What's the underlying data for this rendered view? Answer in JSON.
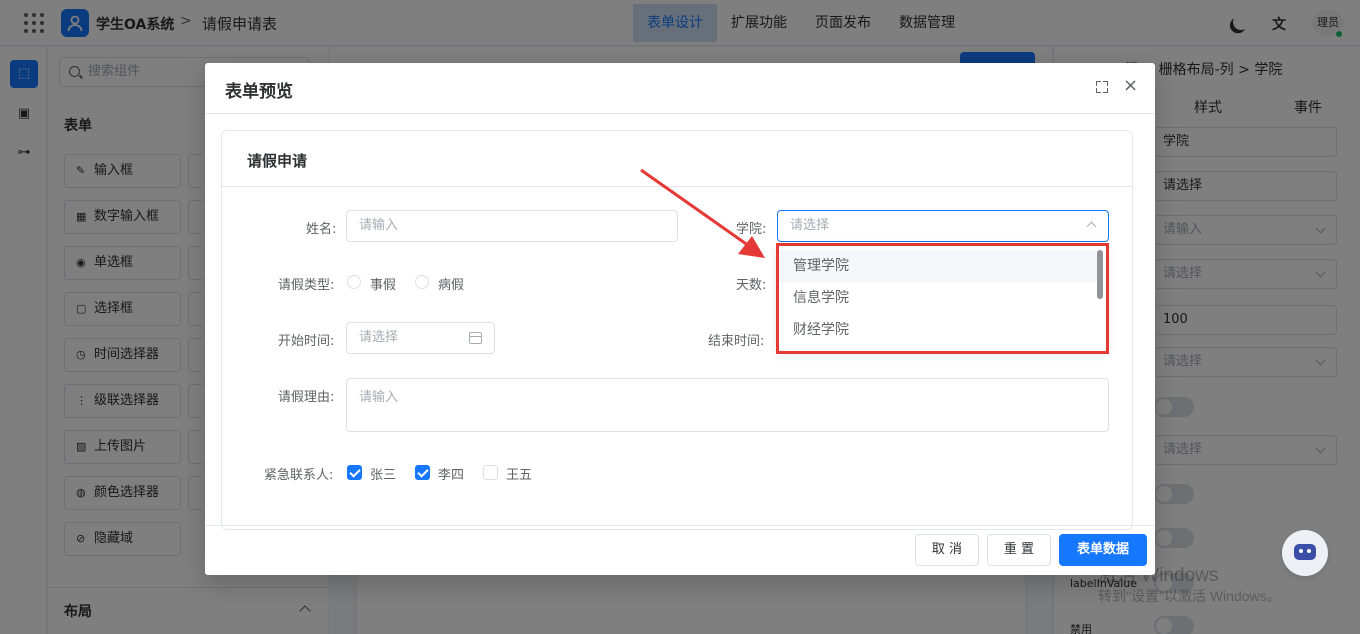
{
  "header": {
    "app_name": "学生OA系统",
    "breadcrumb_sep": ">",
    "page_name": "请假申请表",
    "tabs": [
      {
        "label": "表单设计",
        "active": true
      },
      {
        "label": "扩展功能"
      },
      {
        "label": "页面发布"
      },
      {
        "label": "数据管理"
      }
    ],
    "translate_glyph": "文",
    "avatar_text": "理员"
  },
  "components": {
    "search_placeholder": "搜索组件",
    "section_title": "表单",
    "items": [
      "输入框",
      "数字输入框",
      "单选框",
      "选择框",
      "时间选择器",
      "级联选择器",
      "上传图片",
      "颜色选择器",
      "隐藏域"
    ],
    "layout_title": "布局"
  },
  "props": {
    "breadcrumb": "行 > 栅格布局-列 > 学院",
    "tabs": [
      "样式",
      "事件"
    ],
    "fields": [
      "学院",
      "请选择",
      "请输入",
      "请选择",
      "100",
      "请选择",
      "请选择"
    ],
    "label_in_value": "labelInValue",
    "disabled_label": "禁用"
  },
  "watermark": {
    "line1": "激活 Windows",
    "line2": "转到\"设置\"以激活 Windows。"
  },
  "modal": {
    "title": "表单预览",
    "close_glyph": "×",
    "card_title": "请假申请",
    "fields": {
      "name_label": "姓名:",
      "name_placeholder": "请输入",
      "college_label": "学院:",
      "college_placeholder": "请选择",
      "leave_type_label": "请假类型:",
      "leave_type_options": [
        "事假",
        "病假"
      ],
      "days_label": "天数:",
      "start_label": "开始时间:",
      "start_placeholder": "请选择",
      "end_label": "结束时间:",
      "reason_label": "请假理由:",
      "reason_placeholder": "请输入",
      "contact_label": "紧急联系人:",
      "contacts": [
        {
          "name": "张三",
          "checked": true
        },
        {
          "name": "李四",
          "checked": true
        },
        {
          "name": "王五",
          "checked": false
        }
      ]
    },
    "dropdown_options": [
      "管理学院",
      "信息学院",
      "财经学院"
    ],
    "buttons": {
      "cancel": "取 消",
      "reset": "重 置",
      "submit": "表单数据"
    }
  },
  "colors": {
    "primary": "#1677ff",
    "highlight": "#e53935"
  }
}
